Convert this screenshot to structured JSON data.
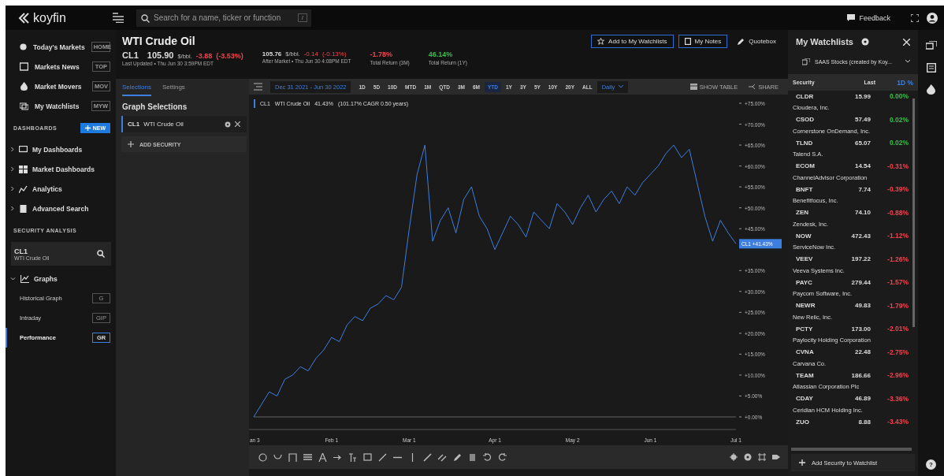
{
  "topbar": {
    "logo": "koyfin",
    "search": {
      "placeholder": "Search for a name, ticker or function",
      "key_hint": "/"
    },
    "feedback": "Feedback"
  },
  "sidebar": {
    "nav": [
      {
        "label": "Today's Markets",
        "shortcut": "HOME"
      },
      {
        "label": "Markets News",
        "shortcut": "TOP"
      },
      {
        "label": "Market Movers",
        "shortcut": "MOV"
      },
      {
        "label": "My Watchlists",
        "shortcut": "MYW"
      }
    ],
    "dashboards_title": "DASHBOARDS",
    "new_button": "NEW",
    "dashboards": [
      {
        "label": "My Dashboards",
        "expanded": false
      },
      {
        "label": "Market Dashboards",
        "expanded": false
      },
      {
        "label": "Analytics",
        "expanded": false
      },
      {
        "label": "Advanced Search",
        "expanded": false
      }
    ],
    "security_title": "SECURITY ANALYSIS",
    "security_field": {
      "ticker": "CL1",
      "name": "WTI Crude Oil"
    },
    "graphs": {
      "label": "Graphs",
      "expanded": true,
      "children": [
        {
          "label": "Historical Graph",
          "shortcut": "G",
          "selected": false
        },
        {
          "label": "Intraday",
          "shortcut": "GIP",
          "selected": false
        },
        {
          "label": "Performance",
          "shortcut": "GR",
          "selected": true
        }
      ]
    }
  },
  "header": {
    "title": "WTI Crude Oil",
    "ticker": "CL1",
    "price": "105.90",
    "unit": "$/bbl.",
    "change": "-3.88",
    "change_pct": "(-3.53%)",
    "updated": "Last Updated • Thu Jun 30 3:59PM EDT",
    "after_price": "105.76",
    "after_unit": "$/bbl.",
    "after_change": "-0.14",
    "after_change_pct": "(-0.13%)",
    "after_updated": "After Market • Thu Jun 30 4:08PM EDT",
    "returns": [
      {
        "value": "-1.78%",
        "label": "Total Return (3M)",
        "color": "#f0434f"
      },
      {
        "value": "46.14%",
        "label": "Total Return (1Y)",
        "color": "#3dbb4d"
      }
    ],
    "buttons": [
      "Add to My Watchlists",
      "My Notes",
      "Quotebox"
    ]
  },
  "panel": {
    "tabs": [
      {
        "label": "Selections",
        "selected": true
      },
      {
        "label": "Settings",
        "selected": false
      }
    ],
    "title": "Graph Selections",
    "selection": {
      "ticker": "CL1",
      "name": "WTI Crude Oil"
    },
    "add": "ADD SECURITY"
  },
  "toolbar": {
    "date_range": "Dec 31 2021 - Jun 30 2022",
    "ranges": [
      {
        "label": "1D",
        "selected": false
      },
      {
        "label": "5D",
        "selected": false
      },
      {
        "label": "10D",
        "selected": false
      },
      {
        "label": "MTD",
        "selected": false
      },
      {
        "label": "1M",
        "selected": false
      },
      {
        "label": "QTD",
        "selected": false
      },
      {
        "label": "3M",
        "selected": false
      },
      {
        "label": "6M",
        "selected": false
      },
      {
        "label": "YTD",
        "selected": true
      },
      {
        "label": "1Y",
        "selected": false
      },
      {
        "label": "3Y",
        "selected": false
      },
      {
        "label": "5Y",
        "selected": false
      },
      {
        "label": "10Y",
        "selected": false
      },
      {
        "label": "20Y",
        "selected": false
      },
      {
        "label": "ALL",
        "selected": false
      }
    ],
    "interval": "Daily",
    "show_table": "SHOW TABLE",
    "share": "SHARE"
  },
  "chart": {
    "legend": {
      "name": "WTI Crude Oil",
      "return": "41.43%",
      "cagr": "(101.17% CAGR 0.50 years)"
    },
    "price_badge": {
      "ticker": "CL1",
      "value": "+41.43%"
    },
    "chart_data": {
      "type": "line",
      "ylim": [
        0,
        75
      ],
      "categories": [
        "an 3",
        null,
        null,
        null,
        null,
        null,
        null,
        null,
        null,
        null,
        "Feb 1",
        null,
        null,
        null,
        null,
        null,
        null,
        null,
        null,
        null,
        "Mar 1",
        null,
        null,
        null,
        null,
        null,
        null,
        null,
        null,
        null,
        null,
        "Apr 1",
        null,
        null,
        null,
        null,
        null,
        null,
        null,
        null,
        null,
        "May 2",
        null,
        null,
        null,
        null,
        null,
        null,
        null,
        null,
        null,
        "Jun 1",
        null,
        null,
        null,
        null,
        null,
        null,
        null,
        null,
        null,
        null,
        "Jul 1"
      ],
      "yticks": [
        {
          "value": 75,
          "label": "+75.00%"
        },
        {
          "value": 70,
          "label": "+70.00%"
        },
        {
          "value": 65,
          "label": "+65.00%"
        },
        {
          "value": 60,
          "label": "+60.00%"
        },
        {
          "value": 55,
          "label": "+55.00%"
        },
        {
          "value": 50,
          "label": "+50.00%"
        },
        {
          "value": 45,
          "label": "+45.00%"
        },
        {
          "value": 35,
          "label": "+35.00%"
        },
        {
          "value": 30,
          "label": "+30.00%"
        },
        {
          "value": 25,
          "label": "+25.00%"
        },
        {
          "value": 20,
          "label": "+20.00%"
        },
        {
          "value": 15,
          "label": "+15.00%"
        },
        {
          "value": 10,
          "label": "+10.00%"
        },
        {
          "value": 5,
          "label": "+5.00%"
        },
        {
          "value": 0,
          "label": "+0.00%"
        }
      ],
      "series": [
        {
          "name": "CL1",
          "color": "#3d7fe0",
          "values": [
            0,
            3,
            6,
            5,
            9,
            10,
            12,
            11,
            14,
            16,
            19,
            18,
            22,
            24,
            23,
            26,
            27,
            29,
            28,
            31,
            45,
            58,
            65,
            42,
            47,
            50,
            44,
            52,
            55,
            48,
            45,
            40,
            44,
            48,
            46,
            43,
            49,
            47,
            45,
            51,
            49,
            46,
            50,
            53,
            49,
            52,
            54,
            51,
            55,
            53,
            56,
            58,
            60,
            63,
            65,
            62,
            64,
            56,
            48,
            42,
            47,
            44,
            41.4
          ]
        }
      ]
    }
  },
  "watchlist": {
    "title": "My Watchlists",
    "list": "SAAS Stocks (created by Koy...",
    "columns": [
      "Security",
      "Last",
      "1D %"
    ],
    "rows": [
      {
        "ticker": "CLDR",
        "last": "15.99",
        "change": "0.00%",
        "color": "#3dbb4d",
        "name": "Cloudera, Inc."
      },
      {
        "ticker": "CSOD",
        "last": "57.49",
        "change": "0.02%",
        "color": "#3dbb4d",
        "name": "Cornerstone OnDemand, Inc."
      },
      {
        "ticker": "TLND",
        "last": "65.07",
        "change": "0.02%",
        "color": "#3dbb4d",
        "name": "Talend S.A."
      },
      {
        "ticker": "ECOM",
        "last": "14.54",
        "change": "-0.31%",
        "color": "#f0434f",
        "name": "ChannelAdvisor Corporation"
      },
      {
        "ticker": "BNFT",
        "last": "7.74",
        "change": "-0.39%",
        "color": "#f0434f",
        "name": "Benefitfocus, Inc."
      },
      {
        "ticker": "ZEN",
        "last": "74.10",
        "change": "-0.88%",
        "color": "#f0434f",
        "name": "Zendesk, Inc."
      },
      {
        "ticker": "NOW",
        "last": "472.43",
        "change": "-1.12%",
        "color": "#f0434f",
        "name": "ServiceNow Inc."
      },
      {
        "ticker": "VEEV",
        "last": "197.22",
        "change": "-1.26%",
        "color": "#f0434f",
        "name": "Veeva Systems Inc."
      },
      {
        "ticker": "PAYC",
        "last": "279.44",
        "change": "-1.57%",
        "color": "#f0434f",
        "name": "Paycom Software, Inc."
      },
      {
        "ticker": "NEWR",
        "last": "49.83",
        "change": "-1.79%",
        "color": "#f0434f",
        "name": "New Relic, Inc."
      },
      {
        "ticker": "PCTY",
        "last": "173.00",
        "change": "-2.01%",
        "color": "#f0434f",
        "name": "Paylocity Holding Corporation"
      },
      {
        "ticker": "CVNA",
        "last": "22.48",
        "change": "-2.75%",
        "color": "#f0434f",
        "name": "Carvana Co."
      },
      {
        "ticker": "TEAM",
        "last": "186.66",
        "change": "-2.96%",
        "color": "#f0434f",
        "name": "Atlassian Corporation Plc"
      },
      {
        "ticker": "CDAY",
        "last": "46.89",
        "change": "-3.36%",
        "color": "#f0434f",
        "name": "Ceridian HCM Holding Inc."
      },
      {
        "ticker": "ZUO",
        "last": "8.88",
        "change": "-3.43%",
        "color": "#f0434f"
      }
    ],
    "add": "Add Security to Watchlist"
  },
  "help": "?"
}
